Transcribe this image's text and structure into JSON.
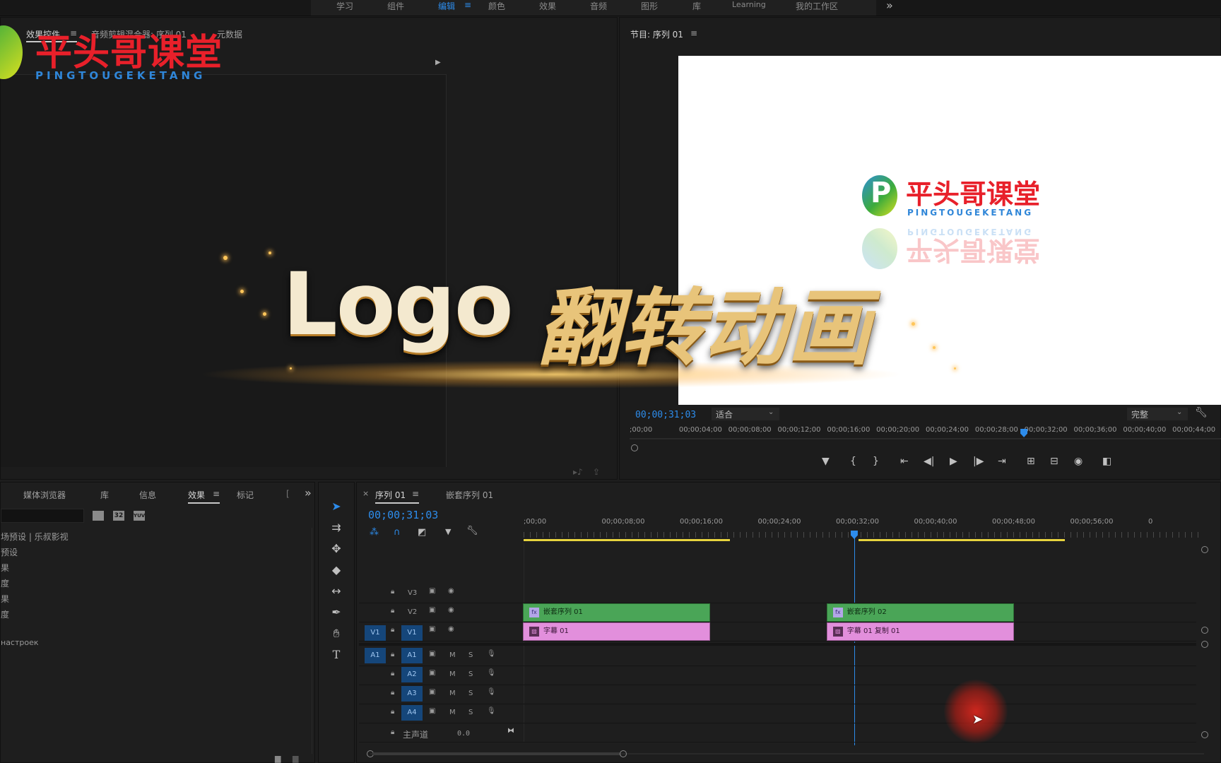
{
  "workspace_tabs": [
    "学习",
    "组件",
    "编辑",
    "颜色",
    "效果",
    "音频",
    "图形",
    "库",
    "Learning",
    "我的工作区"
  ],
  "workspace_active": "编辑",
  "workspace_overflow": "»",
  "source_panel": {
    "tabs": [
      "效果控件",
      "音频剪辑混合器: 序列 01",
      "元数据"
    ]
  },
  "watermark": {
    "name": "平头哥课堂",
    "pinyin": "PINGTOUGEKETANG"
  },
  "title_overlay": {
    "latin": "Logo",
    "cjk": "翻转动画"
  },
  "program_monitor": {
    "title": "节目: 序列 01",
    "menu_icon": "≡",
    "timecode": "00;00;31;03",
    "fit": "适合",
    "quality": "完整",
    "frame_logo": {
      "name": "平头哥课堂",
      "pinyin": "PINGTOUGEKETANG"
    },
    "ruler": [
      ";00;00",
      "00;00;04;00",
      "00;00;08;00",
      "00;00;12;00",
      "00;00;16;00",
      "00;00;20;00",
      "00;00;24;00",
      "00;00;28;00",
      "00;00;32;00",
      "00;00;36;00",
      "00;00;40;00",
      "00;00;44;00"
    ],
    "playhead_fraction": 0.66
  },
  "project_panel": {
    "tabs": [
      "媒体浏览器",
      "库",
      "信息",
      "效果",
      "标记"
    ],
    "active": "效果",
    "overflow": "»",
    "icon_buttons": [
      "32",
      "YUV"
    ],
    "items": [
      "场预设 | 乐叔影视",
      "预设",
      "果",
      "度",
      "果",
      "度",
      "настроек"
    ]
  },
  "timeline": {
    "tabs": [
      "序列 01",
      "嵌套序列 01"
    ],
    "close": "×",
    "timecode": "00;00;31;03",
    "ruler": [
      ";00;00",
      "00;00;08;00",
      "00;00;16;00",
      "00;00;24;00",
      "00;00;32;00",
      "00;00;40;00",
      "00;00;48;00",
      "00;00;56;00",
      "0"
    ],
    "playhead_fraction": 0.49,
    "video_tracks": [
      "V3",
      "V2",
      "V1"
    ],
    "audio_tracks": [
      "A1",
      "A2",
      "A3",
      "A4"
    ],
    "source_v": "V1",
    "source_a": "A1",
    "mute": "M",
    "solo": "S",
    "master_label": "主声道",
    "master_value": "0.0",
    "clips": [
      {
        "track": "V2",
        "name": "嵌套序列 01",
        "start_s": 0,
        "end_s": 19.2,
        "kind": "nest"
      },
      {
        "track": "V1",
        "name": "字幕 01",
        "start_s": 0,
        "end_s": 19.2,
        "kind": "title"
      },
      {
        "track": "V2",
        "name": "嵌套序列 02",
        "start_s": 31.1,
        "end_s": 50.3,
        "kind": "nest"
      },
      {
        "track": "V1",
        "name": "字幕 01 复制 01",
        "start_s": 31.1,
        "end_s": 50.3,
        "kind": "title"
      }
    ]
  },
  "colors": {
    "accent": "#2d8ceb",
    "clip_green": "#4aa557",
    "clip_pink": "#e28fdc",
    "logo_red": "#e8202a",
    "logo_blue": "#2f86d8"
  }
}
